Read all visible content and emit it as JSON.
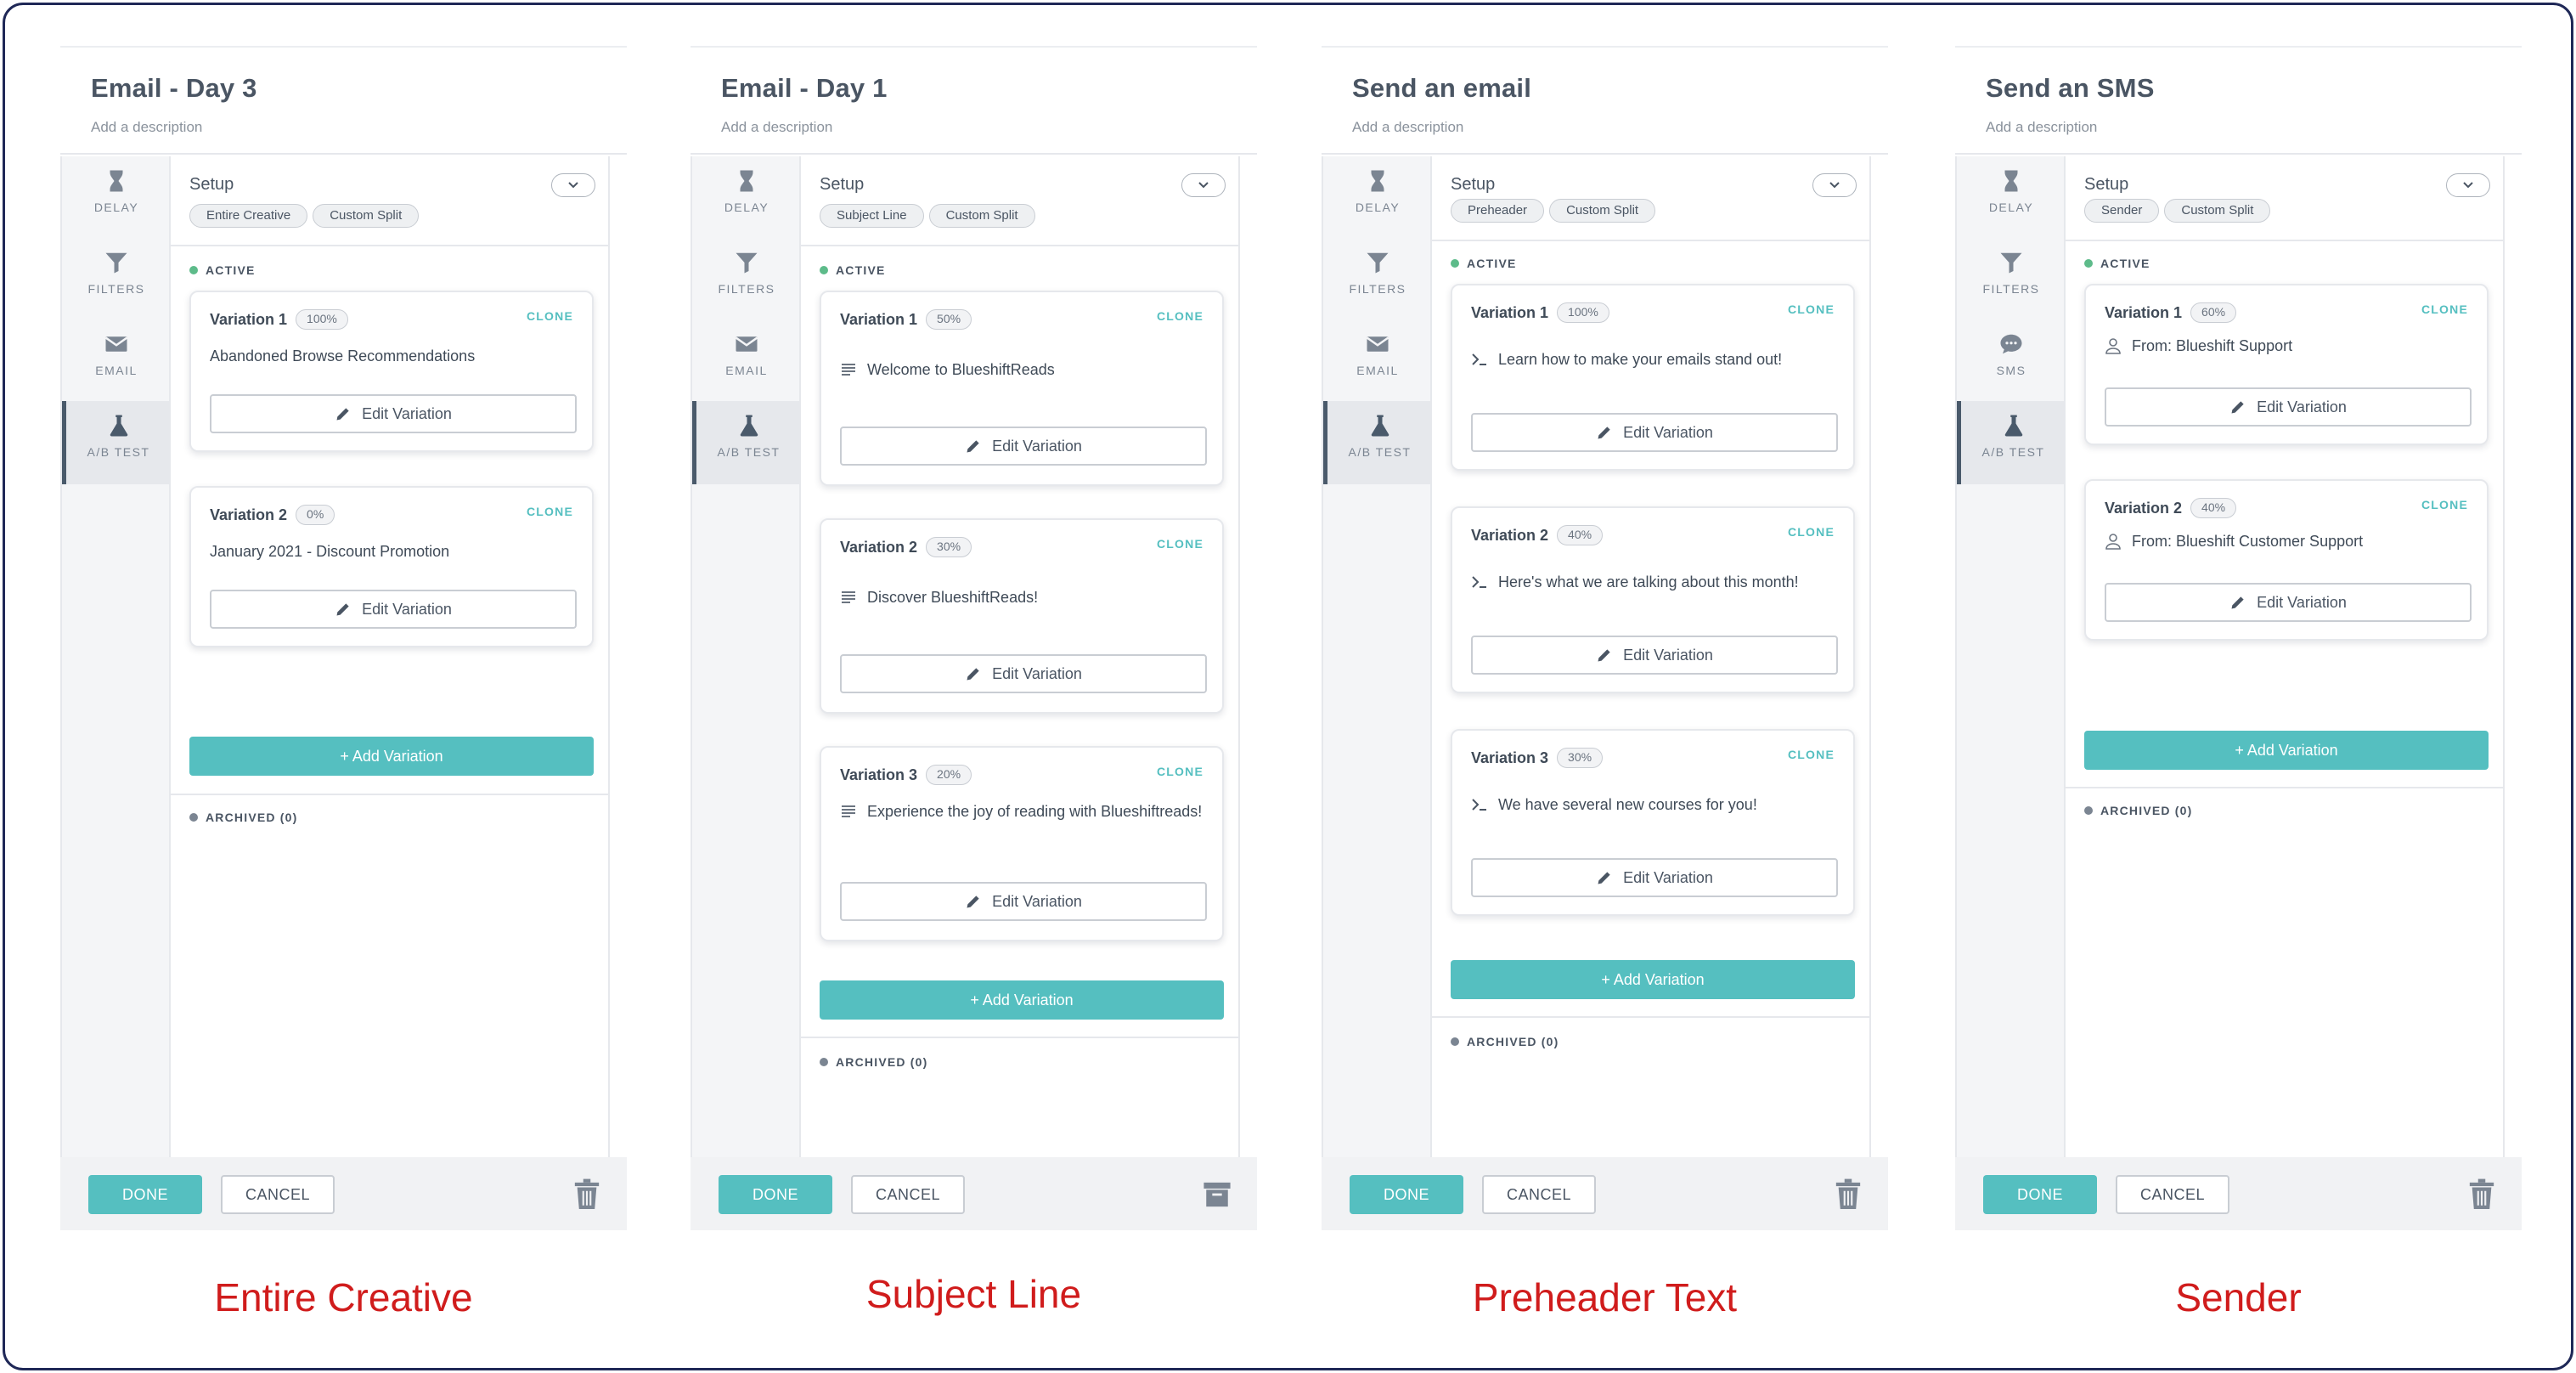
{
  "colors": {
    "accent": "#55bfc0",
    "active_dot": "#5dbb8a",
    "archived_dot": "#7b8592",
    "caption": "#d01c1c",
    "border": "#1f2857"
  },
  "rail_labels": {
    "delay": "DELAY",
    "filters": "FILTERS",
    "email": "EMAIL",
    "sms": "SMS",
    "ab_test": "A/B TEST"
  },
  "common": {
    "setup": "Setup",
    "active": "ACTIVE",
    "archived": "ARCHIVED (0)",
    "clone": "CLONE",
    "edit": "Edit Variation",
    "add": "+ Add Variation",
    "done": "DONE",
    "cancel": "CANCEL"
  },
  "panels": [
    {
      "title": "Email - Day 3",
      "description": "Add a description",
      "chips": [
        "Entire Creative",
        "Custom Split"
      ],
      "variations": [
        {
          "name": "Variation 1",
          "pct": "100%",
          "text": "Abandoned Browse Recommendations"
        },
        {
          "name": "Variation 2",
          "pct": "0%",
          "text": "January 2021 - Discount Promotion"
        }
      ],
      "caption": "Entire Creative"
    },
    {
      "title": "Email - Day 1",
      "description": "Add a description",
      "chips": [
        "Subject Line",
        "Custom Split"
      ],
      "variations": [
        {
          "name": "Variation 1",
          "pct": "50%",
          "text": "Welcome to BlueshiftReads"
        },
        {
          "name": "Variation 2",
          "pct": "30%",
          "text": "Discover BlueshiftReads!"
        },
        {
          "name": "Variation 3",
          "pct": "20%",
          "text": "Experience the joy of reading with Blueshiftreads!"
        }
      ],
      "caption": "Subject Line"
    },
    {
      "title": "Send an email",
      "description": "Add a description",
      "chips": [
        "Preheader",
        "Custom Split"
      ],
      "variations": [
        {
          "name": "Variation 1",
          "pct": "100%",
          "text": "Learn how to make your emails stand out!"
        },
        {
          "name": "Variation 2",
          "pct": "40%",
          "text": "Here's what we are talking about this month!"
        },
        {
          "name": "Variation 3",
          "pct": "30%",
          "text": "We have several new courses for you!"
        }
      ],
      "caption": "Preheader Text"
    },
    {
      "title": "Send an SMS",
      "description": "Add a description",
      "chips": [
        "Sender",
        "Custom Split"
      ],
      "variations": [
        {
          "name": "Variation 1",
          "pct": "60%",
          "text": "From: Blueshift Support"
        },
        {
          "name": "Variation 2",
          "pct": "40%",
          "text": "From: Blueshift Customer Support"
        }
      ],
      "caption": "Sender"
    }
  ]
}
